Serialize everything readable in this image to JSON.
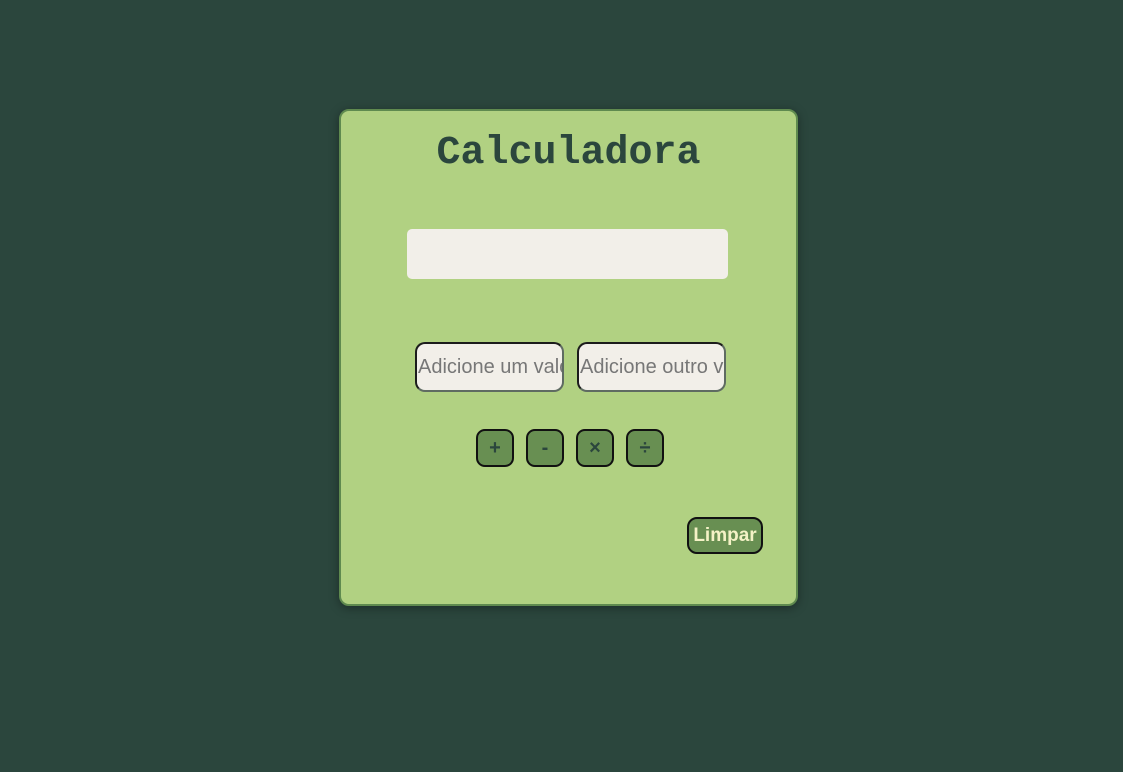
{
  "app": {
    "title": "Calculadora"
  },
  "display": {
    "value": ""
  },
  "inputs": {
    "first_placeholder": "Adicione um valor",
    "second_placeholder": "Adicione outro valor",
    "first_value": "",
    "second_value": ""
  },
  "operations": [
    {
      "label": "+",
      "name": "add"
    },
    {
      "label": "-",
      "name": "subtract"
    },
    {
      "label": "×",
      "name": "multiply"
    },
    {
      "label": "÷",
      "name": "divide"
    }
  ],
  "actions": {
    "clear_label": "Limpar"
  },
  "colors": {
    "background": "#2b463d",
    "card": "#b1d182",
    "button": "#688f52",
    "field": "#f2efe9",
    "title_text": "#2b463d",
    "clear_text": "#f4f2c6"
  }
}
